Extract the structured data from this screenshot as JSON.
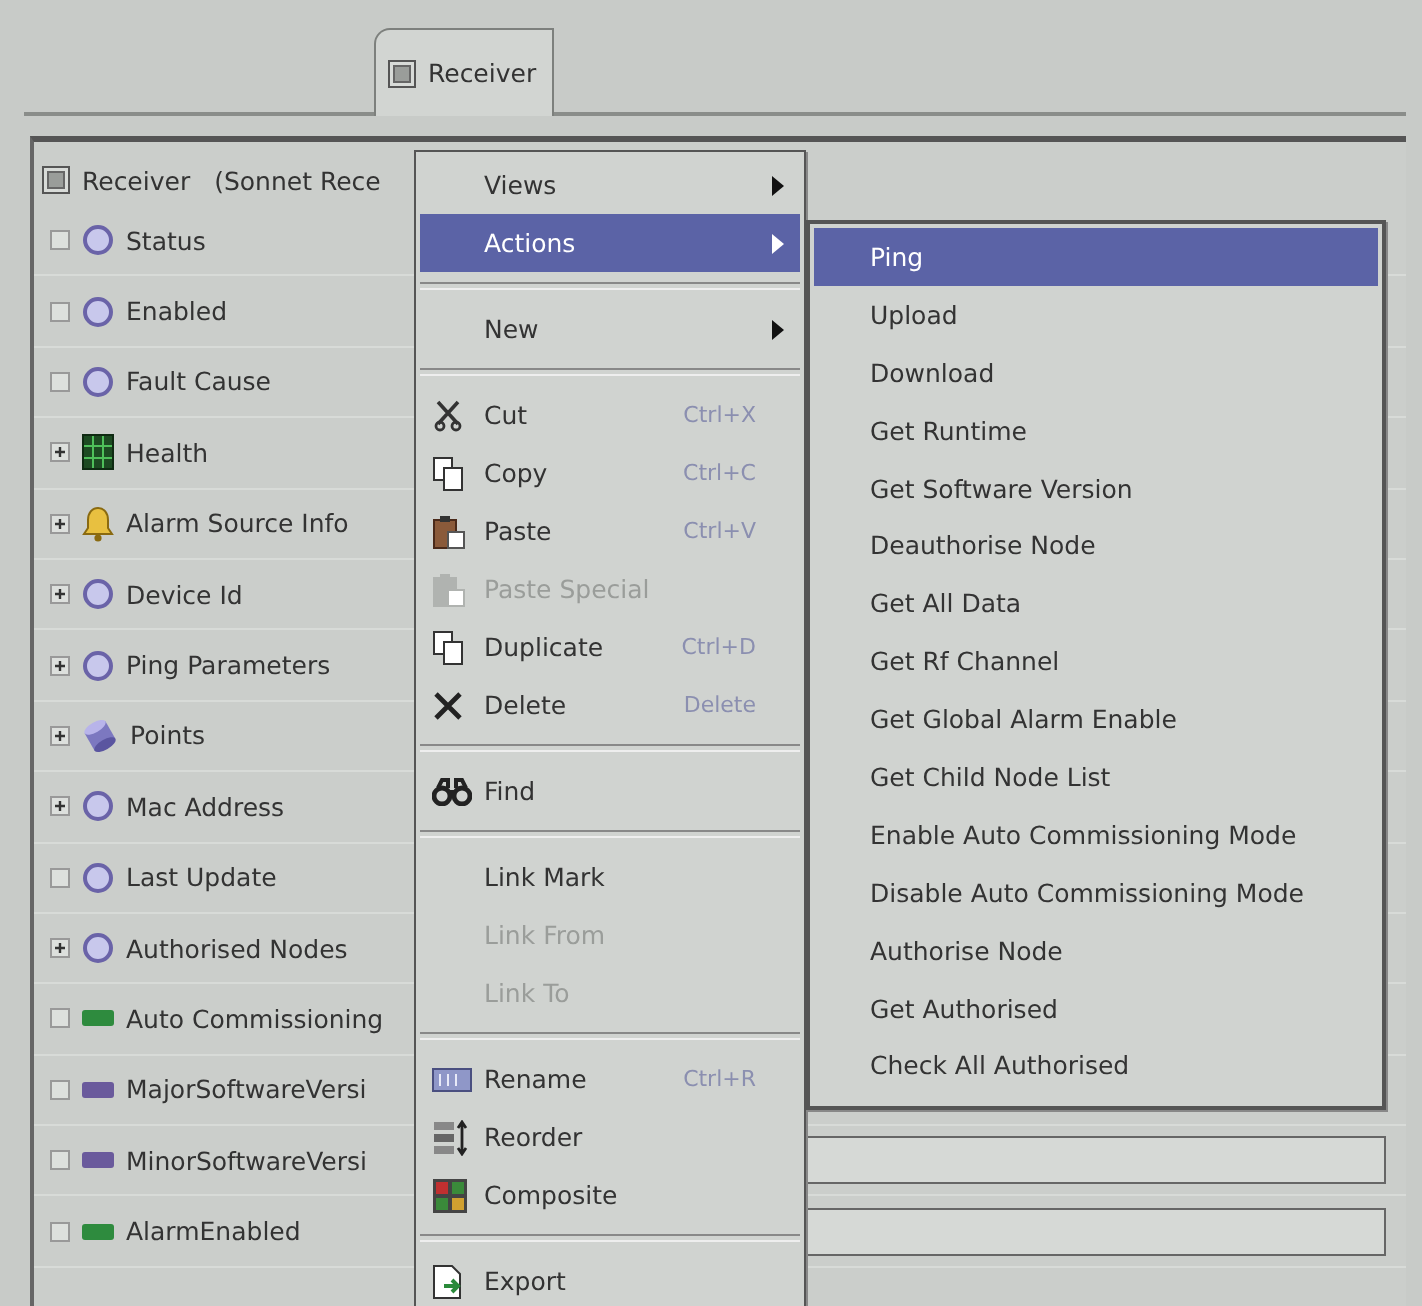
{
  "tabs": [
    {
      "label": "Receiver",
      "selected": true
    }
  ],
  "tree": {
    "root": {
      "label": "Receiver",
      "detail": "(Sonnet Rece"
    },
    "items": [
      {
        "label": "Status",
        "expandable": false,
        "kind": "circle",
        "has_value_field": false
      },
      {
        "label": "Enabled",
        "expandable": false,
        "kind": "circle",
        "has_value_field": false
      },
      {
        "label": "Fault Cause",
        "expandable": false,
        "kind": "circle",
        "has_value_field": false
      },
      {
        "label": "Health",
        "expandable": true,
        "kind": "grid",
        "has_value_field": false
      },
      {
        "label": "Alarm Source Info",
        "expandable": true,
        "kind": "bell",
        "has_value_field": false
      },
      {
        "label": "Device Id",
        "expandable": true,
        "kind": "circle",
        "has_value_field": false
      },
      {
        "label": "Ping Parameters",
        "expandable": true,
        "kind": "circle",
        "has_value_field": false
      },
      {
        "label": "Points",
        "expandable": true,
        "kind": "cylinder",
        "has_value_field": false
      },
      {
        "label": "Mac Address",
        "expandable": true,
        "kind": "circle",
        "has_value_field": false
      },
      {
        "label": "Last Update",
        "expandable": false,
        "kind": "circle",
        "has_value_field": false
      },
      {
        "label": "Authorised Nodes",
        "expandable": true,
        "kind": "circle",
        "has_value_field": false
      },
      {
        "label": "Auto Commissioning",
        "expandable": false,
        "kind": "slot",
        "color": "#2e8b3e",
        "has_value_field": false
      },
      {
        "label": "MajorSoftwareVersi",
        "expandable": false,
        "kind": "slot",
        "color": "#6a5a9c",
        "has_value_field": false
      },
      {
        "label": "MinorSoftwareVersi",
        "expandable": false,
        "kind": "slot",
        "color": "#6a5a9c",
        "has_value_field": true
      },
      {
        "label": "AlarmEnabled",
        "expandable": false,
        "kind": "slot",
        "color": "#2e8b3e",
        "has_value_field": true
      }
    ]
  },
  "context_menu": [
    {
      "kind": "plain",
      "label": "Views",
      "submenu": true,
      "selected": false,
      "disabled": false
    },
    {
      "kind": "plain",
      "label": "Actions",
      "submenu": true,
      "selected": true,
      "disabled": false
    },
    {
      "kind": "separator"
    },
    {
      "kind": "plain",
      "label": "New",
      "submenu": true,
      "selected": false,
      "disabled": false
    },
    {
      "kind": "separator"
    },
    {
      "kind": "cut",
      "label": "Cut",
      "shortcut": "Ctrl+X",
      "submenu": false,
      "selected": false,
      "disabled": false
    },
    {
      "kind": "copy",
      "label": "Copy",
      "shortcut": "Ctrl+C",
      "submenu": false,
      "selected": false,
      "disabled": false
    },
    {
      "kind": "paste",
      "label": "Paste",
      "shortcut": "Ctrl+V",
      "submenu": false,
      "selected": false,
      "disabled": false
    },
    {
      "kind": "paste",
      "label": "Paste Special",
      "submenu": false,
      "selected": false,
      "disabled": true
    },
    {
      "kind": "copy",
      "label": "Duplicate",
      "shortcut": "Ctrl+D",
      "submenu": false,
      "selected": false,
      "disabled": false
    },
    {
      "kind": "delete",
      "label": "Delete",
      "shortcut": "Delete",
      "submenu": false,
      "selected": false,
      "disabled": false
    },
    {
      "kind": "separator"
    },
    {
      "kind": "find",
      "label": "Find",
      "submenu": false,
      "selected": false,
      "disabled": false
    },
    {
      "kind": "separator"
    },
    {
      "kind": "plain",
      "label": "Link Mark",
      "submenu": false,
      "selected": false,
      "disabled": false
    },
    {
      "kind": "plain",
      "label": "Link From",
      "submenu": false,
      "selected": false,
      "disabled": true
    },
    {
      "kind": "plain",
      "label": "Link To",
      "submenu": false,
      "selected": false,
      "disabled": true
    },
    {
      "kind": "separator"
    },
    {
      "kind": "rename",
      "label": "Rename",
      "shortcut": "Ctrl+R",
      "submenu": false,
      "selected": false,
      "disabled": false
    },
    {
      "kind": "reorder",
      "label": "Reorder",
      "submenu": false,
      "selected": false,
      "disabled": false
    },
    {
      "kind": "composite",
      "label": "Composite",
      "submenu": false,
      "selected": false,
      "disabled": false
    },
    {
      "kind": "separator"
    },
    {
      "kind": "export",
      "label": "Export",
      "submenu": false,
      "selected": false,
      "disabled": false
    }
  ],
  "actions_submenu": [
    {
      "label": "Ping",
      "selected": true
    },
    {
      "label": "Upload",
      "selected": false
    },
    {
      "label": "Download",
      "selected": false
    },
    {
      "label": "Get Runtime",
      "selected": false
    },
    {
      "label": "Get Software Version",
      "selected": false
    },
    {
      "label": "Deauthorise Node",
      "selected": false
    },
    {
      "label": "Get All Data",
      "selected": false
    },
    {
      "label": "Get Rf Channel",
      "selected": false
    },
    {
      "label": "Get Global Alarm Enable",
      "selected": false
    },
    {
      "label": "Get Child Node List",
      "selected": false
    },
    {
      "label": "Enable Auto Commissioning Mode",
      "selected": false
    },
    {
      "label": "Disable Auto Commissioning Mode",
      "selected": false
    },
    {
      "label": "Authorise Node",
      "selected": false
    },
    {
      "label": "Get Authorised",
      "selected": false
    },
    {
      "label": "Check All Authorised",
      "selected": false
    }
  ]
}
